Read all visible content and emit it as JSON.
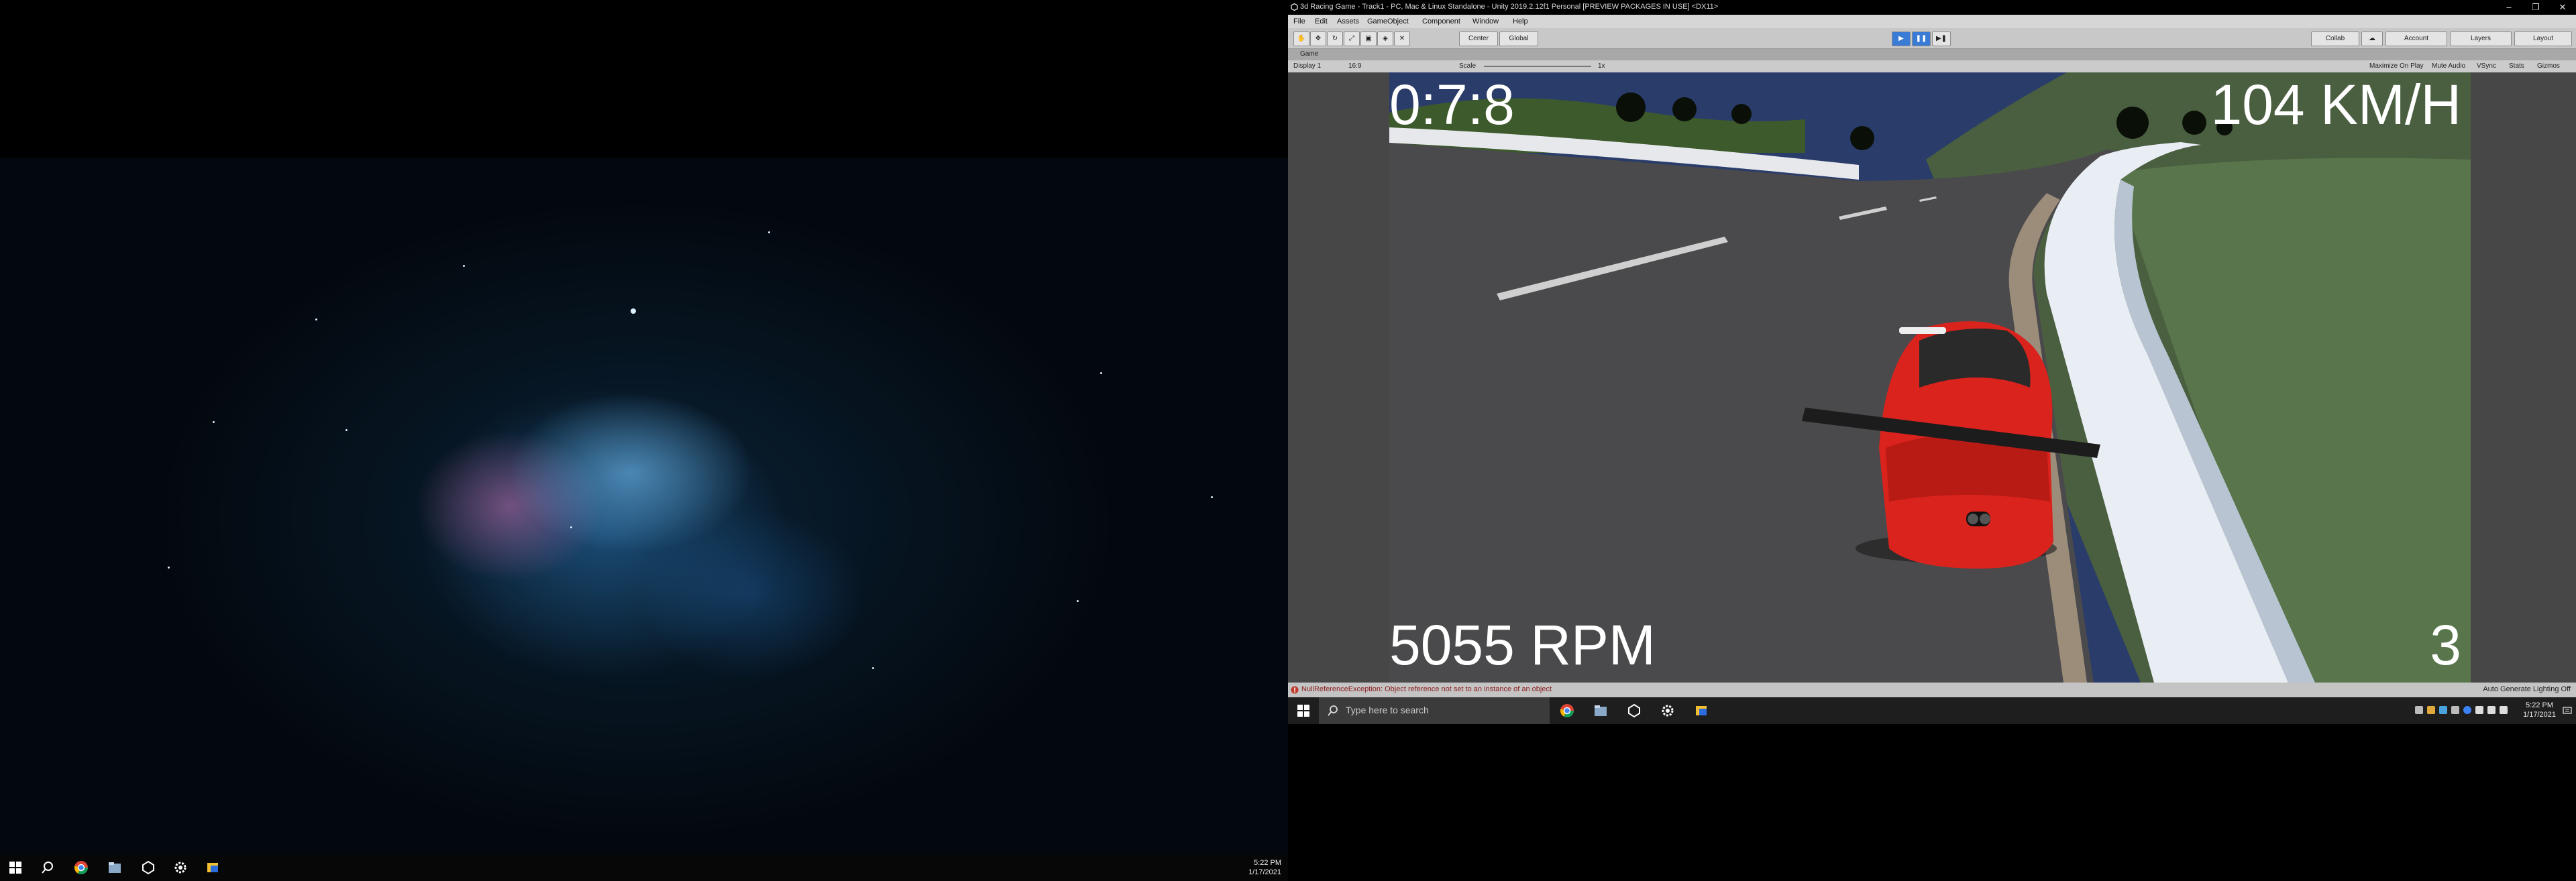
{
  "right_window": {
    "title": "3d Racing Game - Track1 - PC, Mac & Linux Standalone - Unity 2019.2.12f1 Personal [PREVIEW PACKAGES IN USE] <DX11>",
    "menu": [
      "File",
      "Edit",
      "Assets",
      "GameObject",
      "Component",
      "Window",
      "Help"
    ],
    "toolbar": {
      "pivot_label": "Center",
      "space_label": "Global",
      "collab_label": "Collab",
      "account_label": "Account",
      "layers_label": "Layers",
      "layout_label": "Layout"
    },
    "game_tab": "Game",
    "game_controls": {
      "display": "Display 1",
      "aspect": "16:9",
      "scale_label": "Scale",
      "scale_value": "1x",
      "maximize": "Maximize On Play",
      "mute": "Mute Audio",
      "vsync": "VSync",
      "stats": "Stats",
      "gizmos": "Gizmos"
    },
    "hud": {
      "timer": "0:7:8",
      "speed": "104 KM/H",
      "rpm": "5055 RPM",
      "gear": "3"
    },
    "status": {
      "error": "NullReferenceException: Object reference not set to an instance of an object",
      "lighting": "Auto Generate Lighting Off"
    },
    "taskbar": {
      "search_placeholder": "Type here to search",
      "time": "5:22 PM",
      "date": "1/17/2021"
    }
  },
  "left_taskbar": {
    "time": "5:22 PM",
    "date": "1/17/2021"
  },
  "colors": {
    "unity_bg": "#c2c2c2",
    "car_red": "#d9231c",
    "sky": "#2a3c6a",
    "hud_text": "#ffffff"
  }
}
